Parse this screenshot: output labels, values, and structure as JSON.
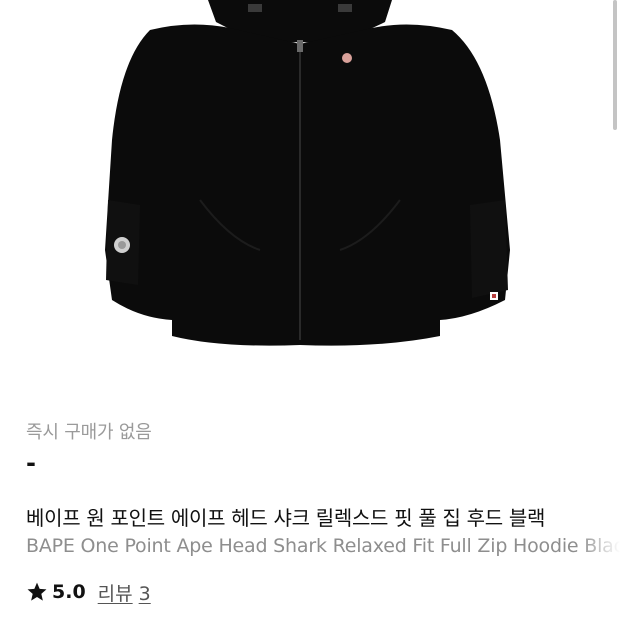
{
  "product": {
    "status_label": "즉시 구매가 없음",
    "price": "-",
    "title_ko": "베이프 원 포인트 에이프 헤드 샤크 릴렉스드 핏 풀 집 후드 블랙",
    "title_en": "BAPE One Point Ape Head Shark Relaxed Fit Full Zip Hoodie Black",
    "image_icon": "black-zip-hoodie-product-image"
  },
  "rating": {
    "icon": "star-icon",
    "value": "5.0",
    "review_label": "리뷰",
    "review_count": "3"
  },
  "colors": {
    "background": "#ffffff",
    "garment": "#0b0b0b",
    "muted_text": "#9a9a9a"
  }
}
